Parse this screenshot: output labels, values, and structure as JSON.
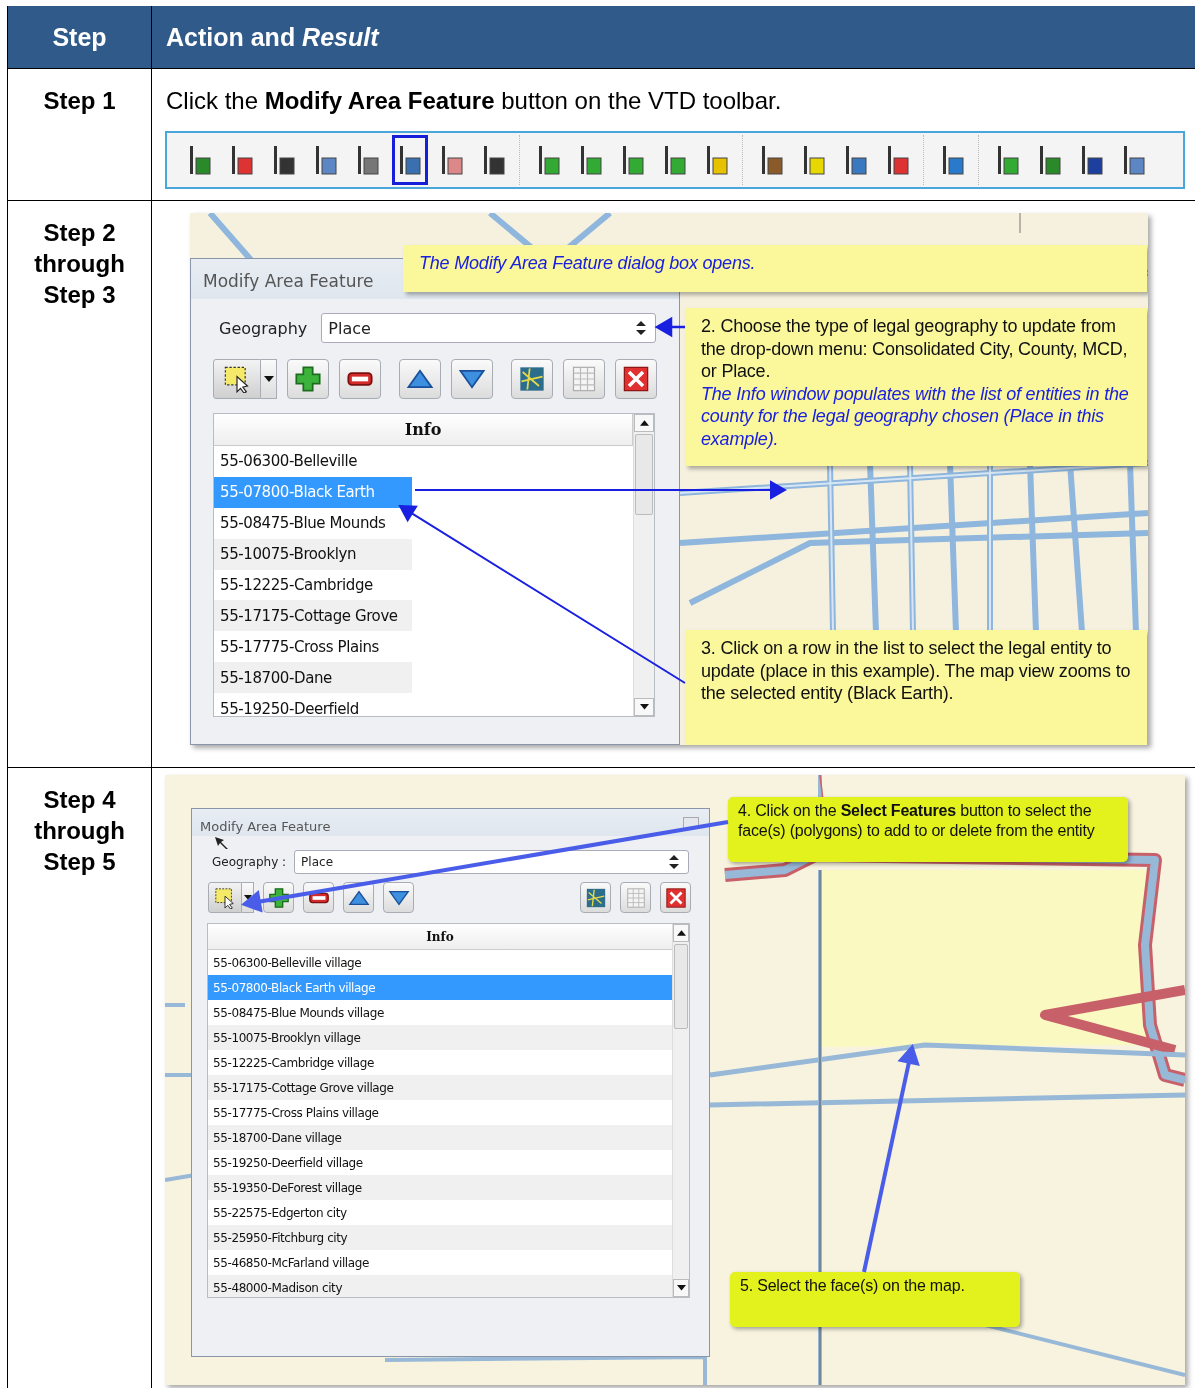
{
  "table": {
    "columns": [
      "Step",
      "Action and *Result*"
    ],
    "rows": [
      {
        "step": "Step 1",
        "instruction": "Click the **Modify Area Feature** button on the VTD toolbar.",
        "toolbar": {
          "groups": [
            [
              {
                "selected": false
              },
              {
                "selected": false
              },
              {
                "selected": false
              },
              {
                "selected": false
              },
              {
                "selected": false
              },
              {
                "selected": true
              },
              {
                "selected": false
              },
              {
                "selected": false
              }
            ],
            [
              {
                "selected": false
              },
              {
                "selected": false
              },
              {
                "selected": false
              },
              {
                "selected": false
              },
              {
                "selected": false
              }
            ],
            [
              {
                "selected": false
              },
              {
                "selected": false
              },
              {
                "selected": false
              },
              {
                "selected": false
              }
            ],
            [
              {
                "selected": false
              }
            ],
            [
              {
                "selected": false
              },
              {
                "selected": false
              },
              {
                "selected": false
              },
              {
                "selected": false
              }
            ]
          ]
        }
      },
      {
        "step": "Step 2 through Step 3",
        "screenshot": {
          "dialog": {
            "title": "Modify Area Feature",
            "geography_label": "Geography",
            "geography_value": "Place",
            "buttons": [
              {
                "kind": "select"
              },
              {
                "kind": "add"
              },
              {
                "kind": "remove"
              },
              {
                "kind": "up"
              },
              {
                "kind": "down"
              },
              {
                "kind": "map"
              },
              {
                "kind": "table"
              },
              {
                "kind": "close"
              }
            ],
            "list_header": "Info",
            "items": [
              {
                "label": "55-06300-Belleville",
                "selected": false
              },
              {
                "label": "55-07800-Black Earth",
                "selected": true
              },
              {
                "label": "55-08475-Blue Mounds",
                "selected": false
              },
              {
                "label": "55-10075-Brooklyn",
                "selected": false
              },
              {
                "label": "55-12225-Cambridge",
                "selected": false
              },
              {
                "label": "55-17175-Cottage Grove",
                "selected": false
              },
              {
                "label": "55-17775-Cross Plains",
                "selected": false
              },
              {
                "label": "55-18700-Dane",
                "selected": false
              },
              {
                "label": "55-19250-Deerfield",
                "selected": false
              }
            ]
          },
          "callouts": [
            {
              "kind": "pale",
              "paragraphs": [
                {
                  "kind": "note",
                  "text": "The Modify Area Feature dialog box opens."
                }
              ]
            },
            {
              "kind": "pale",
              "paragraphs": [
                {
                  "kind": "plain",
                  "text": "2. Choose the type of legal geography to update from the drop-down menu:  Consolidated City, County, MCD, or Place."
                },
                {
                  "kind": "note",
                  "text": "The Info window populates with the list of entities in the county for the legal geography chosen (Place in this example)."
                }
              ]
            },
            {
              "kind": "pale",
              "paragraphs": [
                {
                  "kind": "plain",
                  "text": "3. Click on a row in the list to select the legal entity to update (place in this example).  The map view zooms to the selected entity (Black Earth)."
                }
              ]
            }
          ]
        }
      },
      {
        "step": "Step 4 through Step 5",
        "screenshot": {
          "dialog": {
            "title": "Modify Area Feature",
            "geography_label": "Geography :",
            "geography_value": "Place",
            "buttons": [
              {
                "kind": "select"
              },
              {
                "kind": "add"
              },
              {
                "kind": "remove"
              },
              {
                "kind": "up"
              },
              {
                "kind": "down"
              },
              {
                "kind": "map"
              },
              {
                "kind": "table"
              },
              {
                "kind": "close"
              }
            ],
            "list_header": "Info",
            "items": [
              {
                "label": "55-06300-Belleville village",
                "selected": false
              },
              {
                "label": "55-07800-Black Earth village",
                "selected": true
              },
              {
                "label": "55-08475-Blue Mounds village",
                "selected": false
              },
              {
                "label": "55-10075-Brooklyn village",
                "selected": false
              },
              {
                "label": "55-12225-Cambridge village",
                "selected": false
              },
              {
                "label": "55-17175-Cottage Grove village",
                "selected": false
              },
              {
                "label": "55-17775-Cross Plains village",
                "selected": false
              },
              {
                "label": "55-18700-Dane village",
                "selected": false
              },
              {
                "label": "55-19250-Deerfield village",
                "selected": false
              },
              {
                "label": "55-19350-DeForest village",
                "selected": false
              },
              {
                "label": "55-22575-Edgerton city",
                "selected": false
              },
              {
                "label": "55-25950-Fitchburg city",
                "selected": false
              },
              {
                "label": "55-46850-McFarland village",
                "selected": false
              },
              {
                "label": "55-48000-Madison city",
                "selected": false
              }
            ]
          },
          "callouts": [
            {
              "kind": "lime",
              "paragraphs": [
                {
                  "kind": "plain",
                  "text": "4. Click on the **Select Features** button to select the face(s) (polygons) to add to or delete from the entity"
                }
              ]
            },
            {
              "kind": "lime",
              "paragraphs": [
                {
                  "kind": "plain",
                  "text": "5. Select the face(s) on the map."
                }
              ]
            }
          ]
        }
      }
    ]
  }
}
